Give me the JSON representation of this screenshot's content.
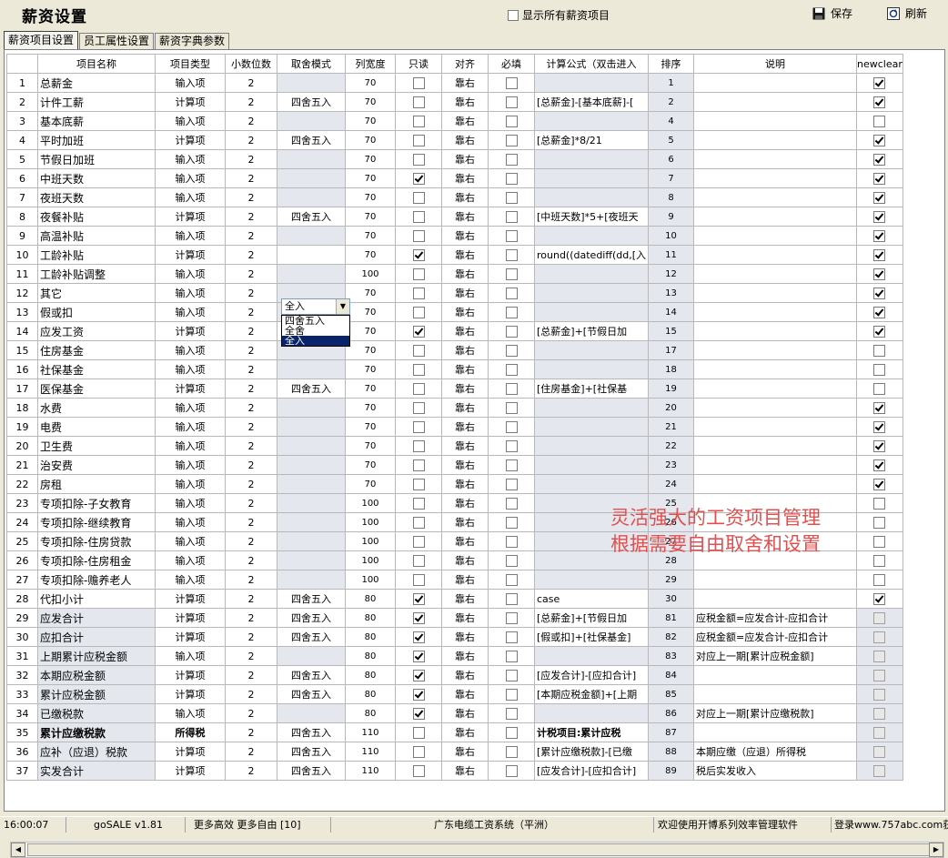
{
  "header": {
    "title": "薪资设置",
    "show_all_label": "显示所有薪资项目",
    "save_label": "保存",
    "refresh_label": "刷新"
  },
  "tabs": [
    "薪资项目设置",
    "员工属性设置",
    "薪资字典参数"
  ],
  "columns": [
    "",
    "项目名称",
    "项目类型",
    "小数位数",
    "取舍模式",
    "列宽度",
    "只读",
    "对齐",
    "必填",
    "计算公式（双击进入",
    "排序",
    "说明",
    "newclear"
  ],
  "rows": [
    {
      "n": "1",
      "name": "总薪金",
      "type": "输入项",
      "dec": "2",
      "round": "",
      "width": "70",
      "ro": false,
      "align": "靠右",
      "req": false,
      "formula": "",
      "sort": "1",
      "desc": "",
      "nc": true
    },
    {
      "n": "2",
      "name": "计件工薪",
      "type": "计算项",
      "dec": "2",
      "round": "四舍五入",
      "width": "70",
      "ro": false,
      "align": "靠右",
      "req": false,
      "formula": "[总薪金]-[基本底薪]-[",
      "sort": "2",
      "desc": "",
      "nc": true
    },
    {
      "n": "3",
      "name": "基本底薪",
      "type": "输入项",
      "dec": "2",
      "round": "",
      "width": "70",
      "ro": false,
      "align": "靠右",
      "req": false,
      "formula": "",
      "sort": "4",
      "desc": "",
      "nc": false
    },
    {
      "n": "4",
      "name": "平时加班",
      "type": "计算项",
      "dec": "2",
      "round": "四舍五入",
      "width": "70",
      "ro": false,
      "align": "靠右",
      "req": false,
      "formula": "[总薪金]*8/21",
      "sort": "5",
      "desc": "",
      "nc": true
    },
    {
      "n": "5",
      "name": "节假日加班",
      "type": "输入项",
      "dec": "2",
      "round": "",
      "width": "70",
      "ro": false,
      "align": "靠右",
      "req": false,
      "formula": "",
      "sort": "6",
      "desc": "",
      "nc": true
    },
    {
      "n": "6",
      "name": "中班天数",
      "type": "输入项",
      "dec": "2",
      "round": "",
      "width": "70",
      "ro": true,
      "align": "靠右",
      "req": false,
      "formula": "",
      "sort": "7",
      "desc": "",
      "nc": true
    },
    {
      "n": "7",
      "name": "夜班天数",
      "type": "输入项",
      "dec": "2",
      "round": "",
      "width": "70",
      "ro": false,
      "align": "靠右",
      "req": false,
      "formula": "",
      "sort": "8",
      "desc": "",
      "nc": true
    },
    {
      "n": "8",
      "name": "夜餐补贴",
      "type": "计算项",
      "dec": "2",
      "round": "四舍五入",
      "width": "70",
      "ro": false,
      "align": "靠右",
      "req": false,
      "formula": "[中班天数]*5+[夜班天",
      "sort": "9",
      "desc": "",
      "nc": true
    },
    {
      "n": "9",
      "name": "高温补贴",
      "type": "输入项",
      "dec": "2",
      "round": "",
      "width": "70",
      "ro": false,
      "align": "靠右",
      "req": false,
      "formula": "",
      "sort": "10",
      "desc": "",
      "nc": true
    },
    {
      "n": "10",
      "name": "工龄补贴",
      "type": "计算项",
      "dec": "2",
      "round": "全入",
      "width": "70",
      "ro": true,
      "align": "靠右",
      "req": false,
      "formula": "round((datediff(dd,[入",
      "sort": "11",
      "desc": "",
      "nc": true
    },
    {
      "n": "11",
      "name": "工龄补贴调整",
      "type": "输入项",
      "dec": "2",
      "round": "",
      "width": "100",
      "ro": false,
      "align": "靠右",
      "req": false,
      "formula": "",
      "sort": "12",
      "desc": "",
      "nc": true
    },
    {
      "n": "12",
      "name": "其它",
      "type": "输入项",
      "dec": "2",
      "round": "",
      "width": "70",
      "ro": false,
      "align": "靠右",
      "req": false,
      "formula": "",
      "sort": "13",
      "desc": "",
      "nc": true
    },
    {
      "n": "13",
      "name": "假或扣",
      "type": "输入项",
      "dec": "2",
      "round": "",
      "width": "70",
      "ro": false,
      "align": "靠右",
      "req": false,
      "formula": "",
      "sort": "14",
      "desc": "",
      "nc": true
    },
    {
      "n": "14",
      "name": "应发工资",
      "type": "计算项",
      "dec": "2",
      "round": "四舍五入",
      "width": "70",
      "ro": true,
      "align": "靠右",
      "req": false,
      "formula": "[总薪金]+[节假日加",
      "sort": "15",
      "desc": "",
      "nc": true
    },
    {
      "n": "15",
      "name": "住房基金",
      "type": "输入项",
      "dec": "2",
      "round": "",
      "width": "70",
      "ro": false,
      "align": "靠右",
      "req": false,
      "formula": "",
      "sort": "17",
      "desc": "",
      "nc": false
    },
    {
      "n": "16",
      "name": "社保基金",
      "type": "输入项",
      "dec": "2",
      "round": "",
      "width": "70",
      "ro": false,
      "align": "靠右",
      "req": false,
      "formula": "",
      "sort": "18",
      "desc": "",
      "nc": false
    },
    {
      "n": "17",
      "name": "医保基金",
      "type": "计算项",
      "dec": "2",
      "round": "四舍五入",
      "width": "70",
      "ro": false,
      "align": "靠右",
      "req": false,
      "formula": "[住房基金]+[社保基",
      "sort": "19",
      "desc": "",
      "nc": false
    },
    {
      "n": "18",
      "name": "水费",
      "type": "输入项",
      "dec": "2",
      "round": "",
      "width": "70",
      "ro": false,
      "align": "靠右",
      "req": false,
      "formula": "",
      "sort": "20",
      "desc": "",
      "nc": true
    },
    {
      "n": "19",
      "name": "电费",
      "type": "输入项",
      "dec": "2",
      "round": "",
      "width": "70",
      "ro": false,
      "align": "靠右",
      "req": false,
      "formula": "",
      "sort": "21",
      "desc": "",
      "nc": true
    },
    {
      "n": "20",
      "name": "卫生费",
      "type": "输入项",
      "dec": "2",
      "round": "",
      "width": "70",
      "ro": false,
      "align": "靠右",
      "req": false,
      "formula": "",
      "sort": "22",
      "desc": "",
      "nc": true
    },
    {
      "n": "21",
      "name": "治安费",
      "type": "输入项",
      "dec": "2",
      "round": "",
      "width": "70",
      "ro": false,
      "align": "靠右",
      "req": false,
      "formula": "",
      "sort": "23",
      "desc": "",
      "nc": true
    },
    {
      "n": "22",
      "name": "房租",
      "type": "输入项",
      "dec": "2",
      "round": "",
      "width": "70",
      "ro": false,
      "align": "靠右",
      "req": false,
      "formula": "",
      "sort": "24",
      "desc": "",
      "nc": true
    },
    {
      "n": "23",
      "name": "专项扣除-子女教育",
      "type": "输入项",
      "dec": "2",
      "round": "",
      "width": "100",
      "ro": false,
      "align": "靠右",
      "req": false,
      "formula": "",
      "sort": "25",
      "desc": "",
      "nc": false
    },
    {
      "n": "24",
      "name": "专项扣除-继续教育",
      "type": "输入项",
      "dec": "2",
      "round": "",
      "width": "100",
      "ro": false,
      "align": "靠右",
      "req": false,
      "formula": "",
      "sort": "26",
      "desc": "",
      "nc": false
    },
    {
      "n": "25",
      "name": "专项扣除-住房贷款",
      "type": "输入项",
      "dec": "2",
      "round": "",
      "width": "100",
      "ro": false,
      "align": "靠右",
      "req": false,
      "formula": "",
      "sort": "27",
      "desc": "",
      "nc": false
    },
    {
      "n": "26",
      "name": "专项扣除-住房租金",
      "type": "输入项",
      "dec": "2",
      "round": "",
      "width": "100",
      "ro": false,
      "align": "靠右",
      "req": false,
      "formula": "",
      "sort": "28",
      "desc": "",
      "nc": false
    },
    {
      "n": "27",
      "name": "专项扣除-赡养老人",
      "type": "输入项",
      "dec": "2",
      "round": "",
      "width": "100",
      "ro": false,
      "align": "靠右",
      "req": false,
      "formula": "",
      "sort": "29",
      "desc": "",
      "nc": false
    },
    {
      "n": "28",
      "name": "代扣小计",
      "type": "计算项",
      "dec": "2",
      "round": "四舍五入",
      "width": "80",
      "ro": true,
      "align": "靠右",
      "req": false,
      "formula": "case",
      "sort": "30",
      "desc": "",
      "nc": true
    },
    {
      "n": "29",
      "name": "应发合计",
      "type": "计算项",
      "dec": "2",
      "round": "四舍五入",
      "width": "80",
      "ro": true,
      "align": "靠右",
      "req": false,
      "formula": "[总薪金]+[节假日加",
      "sort": "81",
      "desc": "应税金额=应发合计-应扣合计",
      "nc": false,
      "sys": true
    },
    {
      "n": "30",
      "name": "应扣合计",
      "type": "计算项",
      "dec": "2",
      "round": "四舍五入",
      "width": "80",
      "ro": true,
      "align": "靠右",
      "req": false,
      "formula": "[假或扣]+[社保基金]",
      "sort": "82",
      "desc": "应税金额=应发合计-应扣合计",
      "nc": false,
      "sys": true
    },
    {
      "n": "31",
      "name": "上期累计应税金额",
      "type": "输入项",
      "dec": "2",
      "round": "",
      "width": "80",
      "ro": true,
      "align": "靠右",
      "req": false,
      "formula": "",
      "sort": "83",
      "desc": "对应上一期[累计应税金额]",
      "nc": false,
      "sys": true
    },
    {
      "n": "32",
      "name": "本期应税金额",
      "type": "计算项",
      "dec": "2",
      "round": "四舍五入",
      "width": "80",
      "ro": true,
      "align": "靠右",
      "req": false,
      "formula": "[应发合计]-[应扣合计]",
      "sort": "84",
      "desc": "",
      "nc": false,
      "sys": true
    },
    {
      "n": "33",
      "name": "累计应税金额",
      "type": "计算项",
      "dec": "2",
      "round": "四舍五入",
      "width": "80",
      "ro": true,
      "align": "靠右",
      "req": false,
      "formula": "[本期应税金额]+[上期",
      "sort": "85",
      "desc": "",
      "nc": false,
      "sys": true
    },
    {
      "n": "34",
      "name": "已缴税款",
      "type": "输入项",
      "dec": "2",
      "round": "",
      "width": "80",
      "ro": true,
      "align": "靠右",
      "req": false,
      "formula": "",
      "sort": "86",
      "desc": "对应上一期[累计应缴税款]",
      "nc": false,
      "sys": true
    },
    {
      "n": "35",
      "name": "累计应缴税款",
      "type": "所得税",
      "dec": "2",
      "round": "四舍五入",
      "width": "110",
      "ro": false,
      "align": "靠右",
      "req": false,
      "formula": "计税项目:累计应税",
      "sort": "87",
      "desc": "",
      "nc": false,
      "sys": true,
      "bold": true
    },
    {
      "n": "36",
      "name": "应补（应退）税款",
      "type": "计算项",
      "dec": "2",
      "round": "四舍五入",
      "width": "110",
      "ro": false,
      "align": "靠右",
      "req": false,
      "formula": "[累计应缴税款]-[已缴",
      "sort": "88",
      "desc": "本期应缴（应退）所得税",
      "nc": false,
      "sys": true
    },
    {
      "n": "37",
      "name": "实发合计",
      "type": "计算项",
      "dec": "2",
      "round": "四舍五入",
      "width": "110",
      "ro": false,
      "align": "靠右",
      "req": false,
      "formula": "[应发合计]-[应扣合计]",
      "sort": "89",
      "desc": "税后实发收入",
      "nc": false,
      "sys": true
    }
  ],
  "dropdown": {
    "value": "全入",
    "options": [
      "四舍五入",
      "全舍",
      "全入"
    ],
    "selected_index": 2
  },
  "overlay": {
    "line1": "灵活强大的工资项目管理",
    "line2": "根据需要自由取舍和设置",
    "color": "#e05050"
  },
  "statusbar": {
    "time": "16:00:07",
    "version": "goSALE v1.81",
    "slogan": "更多高效 更多自由 [10]",
    "company": "广东电缆工资系统（平洲）",
    "welcome": "欢迎使用开博系列效率管理软件",
    "site": "登录www.757abc.com获"
  }
}
